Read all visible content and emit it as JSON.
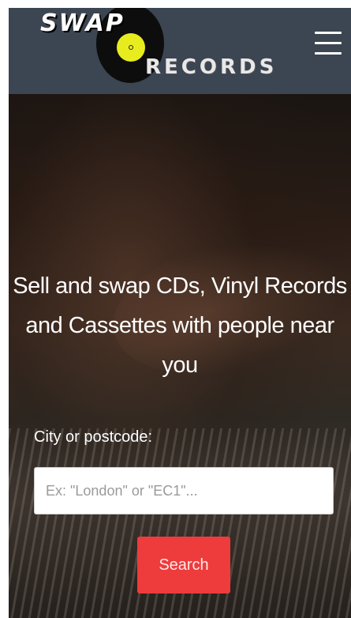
{
  "header": {
    "logo_top": "SWAP",
    "logo_bottom": "RECORDS",
    "menu_icon": "hamburger-menu-icon"
  },
  "hero": {
    "title": "Sell and swap CDs, Vinyl Records and Cassettes with people near you"
  },
  "search": {
    "label": "City or postcode:",
    "placeholder": "Ex: \"London\" or \"EC1\"...",
    "value": "",
    "button_label": "Search"
  },
  "colors": {
    "header_bg": "#3c4552",
    "accent": "#ee3b3b",
    "vinyl_label": "#e8ec1f"
  }
}
